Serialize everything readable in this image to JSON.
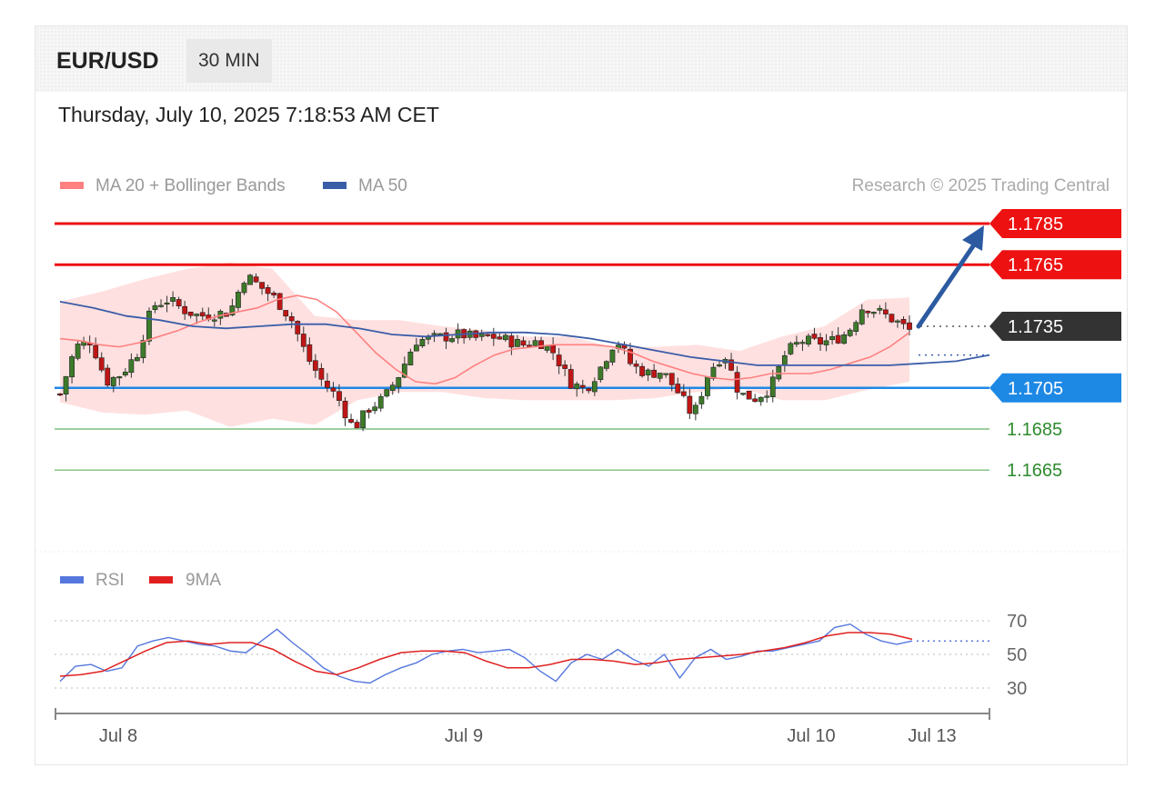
{
  "header": {
    "symbol": "EUR/USD",
    "timeframe": "30 MIN",
    "datetime": "Thursday, July 10, 2025 7:18:53 AM CET"
  },
  "legend": {
    "ma20_label": "MA 20 + Bollinger Bands",
    "ma50_label": "MA 50",
    "copyright": "Research © 2025 Trading Central",
    "rsi_label": "RSI",
    "rsi_ma_label": "9MA"
  },
  "colors": {
    "resistance": "#ee1111",
    "support": "#1e88e5",
    "weak_support": "#3a9a3a",
    "pivot": "#333333",
    "bull": "#3d7a2a",
    "bear": "#c01515",
    "ma50": "#3a5da8",
    "ma20": "#ff8080",
    "band": "#ffdada",
    "rsi": "#5577dd",
    "rsi_ma": "#e02020",
    "arrow": "#2b5aa0"
  },
  "chart_data": [
    {
      "type": "candlestick",
      "title": "EUR/USD 30 MIN",
      "x_ticks": [
        "Jul 8",
        "Jul 9",
        "Jul 10",
        "Jul 13"
      ],
      "ylim": [
        1.1655,
        1.1795
      ],
      "levels": [
        {
          "value": 1.1785,
          "label": "1.1785",
          "kind": "resistance",
          "tag": true
        },
        {
          "value": 1.1765,
          "label": "1.1765",
          "kind": "resistance",
          "tag": true
        },
        {
          "value": 1.1735,
          "label": "1.1735",
          "kind": "pivot",
          "tag": true
        },
        {
          "value": 1.1705,
          "label": "1.1705",
          "kind": "support",
          "tag": true
        },
        {
          "value": 1.1685,
          "label": "1.1685",
          "kind": "weak_support",
          "tag": false
        },
        {
          "value": 1.1665,
          "label": "1.1665",
          "kind": "weak_support",
          "tag": false
        }
      ],
      "close_path": [
        1.1702,
        1.1725,
        1.1728,
        1.1708,
        1.1712,
        1.1722,
        1.1745,
        1.1748,
        1.1743,
        1.174,
        1.1741,
        1.1742,
        1.176,
        1.1754,
        1.1748,
        1.1738,
        1.172,
        1.1708,
        1.17,
        1.1685,
        1.1695,
        1.17,
        1.1712,
        1.1728,
        1.1729,
        1.173,
        1.1731,
        1.1729,
        1.173,
        1.1728,
        1.1726,
        1.1728,
        1.1722,
        1.1708,
        1.1704,
        1.1715,
        1.1729,
        1.1716,
        1.1712,
        1.1713,
        1.1703,
        1.1691,
        1.1713,
        1.1722,
        1.1702,
        1.17,
        1.1705,
        1.1722,
        1.1728,
        1.1727,
        1.1728,
        1.1732,
        1.1745,
        1.1742,
        1.1738,
        1.1733
      ],
      "ma20": [
        1.1729,
        1.1728,
        1.1726,
        1.1725,
        1.1727,
        1.173,
        1.1733,
        1.1737,
        1.174,
        1.1742,
        1.1744,
        1.1748,
        1.175,
        1.1748,
        1.1742,
        1.1732,
        1.1722,
        1.1714,
        1.1708,
        1.1707,
        1.171,
        1.1716,
        1.1721,
        1.1724,
        1.1725,
        1.1726,
        1.1726,
        1.1726,
        1.1725,
        1.1722,
        1.1718,
        1.1715,
        1.1712,
        1.171,
        1.1709,
        1.171,
        1.1712,
        1.1712,
        1.1712,
        1.1714,
        1.1717,
        1.172,
        1.1725,
        1.1732
      ],
      "ma50": [
        1.1747,
        1.1744,
        1.174,
        1.1738,
        1.1735,
        1.1734,
        1.1735,
        1.1736,
        1.1736,
        1.1734,
        1.1731,
        1.173,
        1.1731,
        1.1732,
        1.1732,
        1.1731,
        1.1729,
        1.1726,
        1.1723,
        1.172,
        1.1718,
        1.1716,
        1.1716,
        1.1716,
        1.1716,
        1.1716,
        1.1717,
        1.1718,
        1.1721
      ],
      "bollinger_upper": [
        1.1747,
        1.1752,
        1.1758,
        1.1763,
        1.1766,
        1.1763,
        1.174,
        1.1738,
        1.1738,
        1.1735,
        1.1733,
        1.173,
        1.173,
        1.1725,
        1.1725,
        1.1726,
        1.1723,
        1.173,
        1.1735,
        1.1748,
        1.1749
      ],
      "bollinger_lower": [
        1.1698,
        1.1693,
        1.1692,
        1.1694,
        1.1686,
        1.169,
        1.1687,
        1.1699,
        1.1703,
        1.1703,
        1.17,
        1.1699,
        1.1699,
        1.1699,
        1.17,
        1.1703,
        1.1705,
        1.1699,
        1.1699,
        1.1704,
        1.1708
      ],
      "target_arrow": {
        "from": 1.1735,
        "to": 1.1785
      }
    },
    {
      "type": "line",
      "title": "RSI",
      "ylim": [
        20,
        80
      ],
      "y_ticks": [
        70,
        50,
        30
      ],
      "series": [
        {
          "name": "RSI",
          "values": [
            34,
            43,
            44,
            40,
            42,
            55,
            58,
            60,
            58,
            56,
            55,
            52,
            51,
            58,
            65,
            57,
            50,
            42,
            37,
            34,
            33,
            38,
            42,
            45,
            50,
            52,
            53,
            51,
            52,
            53,
            48,
            40,
            34,
            45,
            50,
            47,
            53,
            47,
            43,
            50,
            36,
            48,
            53,
            47,
            49,
            52,
            52,
            54,
            56,
            58,
            66,
            68,
            62,
            58,
            56,
            58
          ]
        },
        {
          "name": "9MA",
          "values": [
            37,
            38,
            40,
            46,
            52,
            57,
            58,
            56,
            57,
            57,
            53,
            46,
            40,
            38,
            42,
            47,
            51,
            52,
            52,
            51,
            46,
            42,
            42,
            44,
            47,
            47,
            46,
            44,
            45,
            47,
            48,
            49,
            50,
            52,
            54,
            57,
            61,
            63,
            63,
            62,
            59
          ]
        }
      ]
    }
  ]
}
